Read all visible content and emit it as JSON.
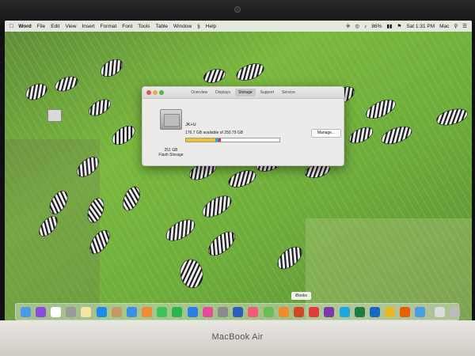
{
  "menubar": {
    "app_name": "Word",
    "items": [
      "File",
      "Edit",
      "View",
      "Insert",
      "Format",
      "Font",
      "Tools",
      "Table",
      "Window"
    ],
    "help": "Help",
    "battery": "86%",
    "clock": "Sat 1:31 PM",
    "user": "Mac"
  },
  "about_window": {
    "tabs": [
      "Overview",
      "Displays",
      "Storage",
      "Support",
      "Service"
    ],
    "selected_tab": "Storage",
    "volume_name": "JK+U",
    "available_text": "176.7 GB available of 250.79 GB",
    "disk_capacity": "251 GB",
    "disk_type": "Flash Storage",
    "manage_button": "Manage...",
    "usage_segments": [
      {
        "fraction": 0.31,
        "color": "#f2c32c"
      },
      {
        "fraction": 0.04,
        "color": "#29a7e0"
      },
      {
        "fraction": 0.02,
        "color": "#e0303a"
      }
    ]
  },
  "dock": {
    "tooltip": "iBooks",
    "icons": [
      {
        "name": "finder-icon",
        "color": "#4c9be8"
      },
      {
        "name": "siri-icon",
        "color": "#8a4fd6"
      },
      {
        "name": "calendar-icon",
        "color": "#ffffff"
      },
      {
        "name": "launchpad-icon",
        "color": "#9a9a9a"
      },
      {
        "name": "notes-icon",
        "color": "#f1e6a3"
      },
      {
        "name": "safari-icon",
        "color": "#1e8be8"
      },
      {
        "name": "contacts-icon",
        "color": "#c49a62"
      },
      {
        "name": "mail-icon",
        "color": "#3d8ee6"
      },
      {
        "name": "photos-icon",
        "color": "#f08a34"
      },
      {
        "name": "messages-icon",
        "color": "#3bc45a"
      },
      {
        "name": "facetime-icon",
        "color": "#28b74a"
      },
      {
        "name": "app-store-icon",
        "color": "#2d7de6"
      },
      {
        "name": "itunes-icon",
        "color": "#e84a9a"
      },
      {
        "name": "system-preferences-icon",
        "color": "#8b8b8b"
      },
      {
        "name": "word-icon",
        "color": "#2b5fb8"
      },
      {
        "name": "music-icon",
        "color": "#f25b7a"
      },
      {
        "name": "maps-icon",
        "color": "#6bbd5b"
      },
      {
        "name": "ibooks-icon",
        "color": "#f08b2c"
      },
      {
        "name": "powerpoint-icon",
        "color": "#d24726"
      },
      {
        "name": "help-icon",
        "color": "#e23b3b"
      },
      {
        "name": "onenote-icon",
        "color": "#7b3aa8"
      },
      {
        "name": "skype-icon",
        "color": "#1fa8e0"
      },
      {
        "name": "excel-icon",
        "color": "#1f7a43"
      },
      {
        "name": "outlook-icon",
        "color": "#1867c4"
      },
      {
        "name": "teams-icon",
        "color": "#e8b82c"
      },
      {
        "name": "firefox-icon",
        "color": "#e66000"
      },
      {
        "name": "chrome-icon",
        "color": "#4a9de0"
      },
      {
        "name": "documents-icon",
        "color": "#dcdcdc"
      },
      {
        "name": "trash-icon",
        "color": "#bcbcbc"
      }
    ]
  }
}
